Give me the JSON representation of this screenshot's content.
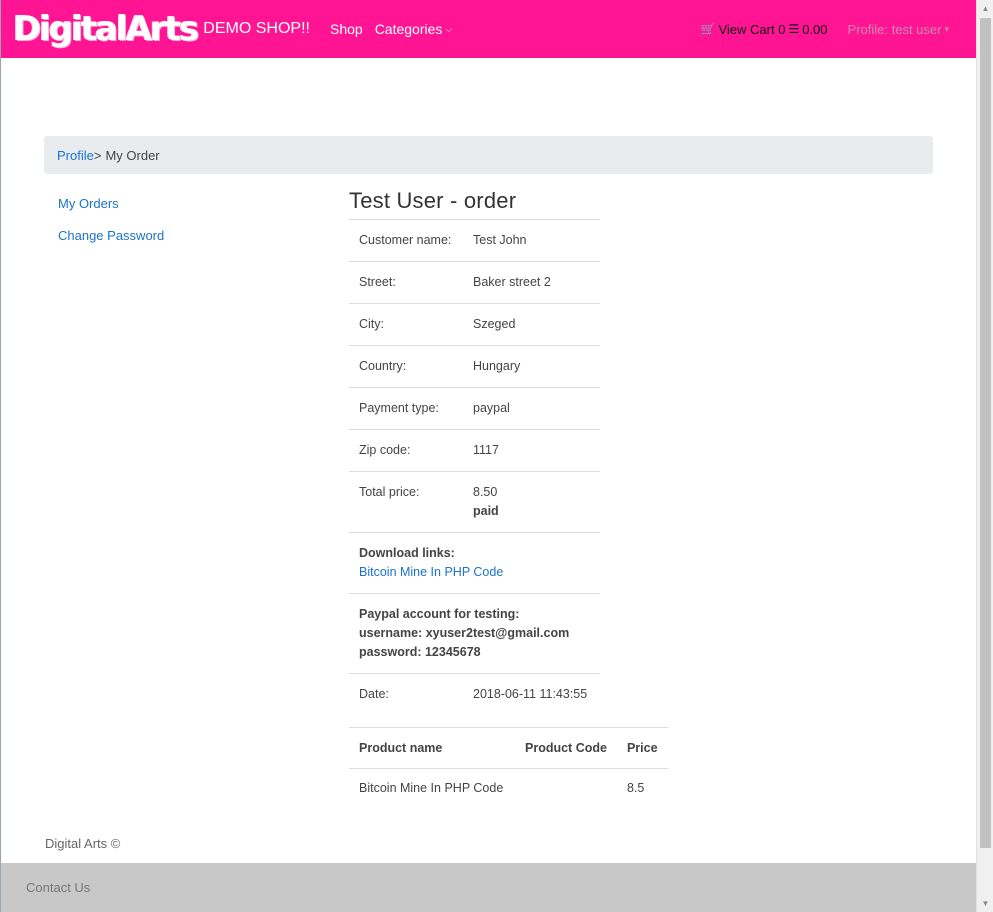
{
  "navbar": {
    "brand_logo": "DigitalArts",
    "brand_text": "DEMO SHOP!!",
    "shop": "Shop",
    "categories": "Categories",
    "cart_label": "View Cart 0",
    "cart_total": "0.00",
    "profile": "Profile: test user",
    "color": "#ff1493"
  },
  "breadcrumb": {
    "profile": "Profile",
    "separator": ">",
    "current": "My Order"
  },
  "sidebar": {
    "items": [
      {
        "label": "My Orders"
      },
      {
        "label": "Change Password"
      }
    ]
  },
  "order": {
    "title": "Test User - order",
    "customer_label": "Customer name:",
    "customer_value": "Test John",
    "street_label": "Street:",
    "street_value": "Baker street 2",
    "city_label": "City:",
    "city_value": "Szeged",
    "country_label": "Country:",
    "country_value": "Hungary",
    "payment_label": "Payment type:",
    "payment_value": "paypal",
    "zip_label": "Zip code:",
    "zip_value": "1117",
    "total_label": "Total price:",
    "total_value": "8.50",
    "total_status": "paid",
    "downloads_label": "Download links:",
    "download_link": "Bitcoin Mine In PHP Code",
    "paypal_title": "Paypal account for testing:",
    "paypal_username": "username: xyuser2test@gmail.com",
    "paypal_password": "password: 12345678",
    "date_label": "Date:",
    "date_value": "2018-06-11 11:43:55"
  },
  "products": {
    "headers": [
      "Product name",
      "Product Code",
      "Price"
    ],
    "rows": [
      {
        "name": "Bitcoin Mine In PHP Code",
        "code": "",
        "price": "8.5"
      }
    ]
  },
  "footer": {
    "copyright": "Digital Arts ©",
    "contact": "Contact Us"
  }
}
